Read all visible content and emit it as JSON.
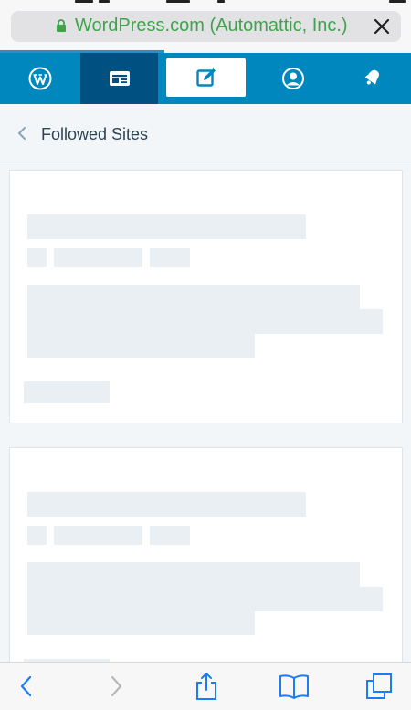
{
  "browser": {
    "url_text": "WordPress.com (Automattic, Inc.)",
    "url_color": "#3fa34d",
    "lock_icon": "lock-icon",
    "close_icon": "close-icon",
    "load_progress": 0.4,
    "toolbar_icons": [
      "back-icon",
      "forward-icon",
      "share-icon",
      "bookmarks-icon",
      "tabs-icon"
    ]
  },
  "masterbar": {
    "background": "#0087be",
    "active_background": "#005082",
    "active_item": "reader",
    "items": [
      {
        "key": "wordpress",
        "icon": "wordpress-logo-icon"
      },
      {
        "key": "reader",
        "icon": "reader-icon"
      },
      {
        "key": "write",
        "icon": "write-post-icon"
      },
      {
        "key": "me",
        "icon": "user-avatar-icon"
      },
      {
        "key": "notifications",
        "icon": "notifications-bell-icon"
      }
    ]
  },
  "header": {
    "back_icon": "chevron-left-icon",
    "title": "Followed Sites"
  },
  "stream": {
    "state": "loading",
    "placeholder_cards_visible": 2
  }
}
